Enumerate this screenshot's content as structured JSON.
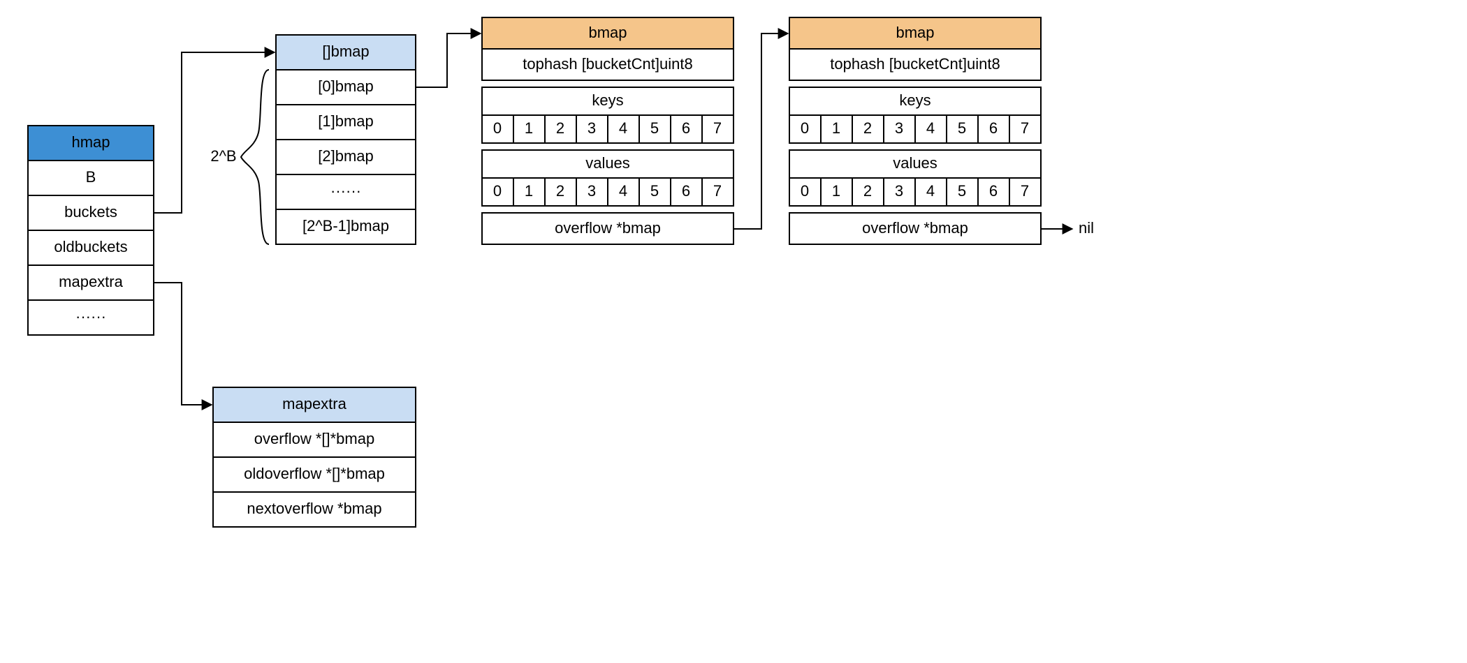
{
  "hmap": {
    "title": "hmap",
    "fields": [
      "B",
      "buckets",
      "oldbuckets",
      "mapextra",
      "······"
    ]
  },
  "bucketArray": {
    "title": "[]bmap",
    "sizeLabel": "2^B",
    "items": [
      "[0]bmap",
      "[1]bmap",
      "[2]bmap",
      "······",
      "[2^B-1]bmap"
    ]
  },
  "bmap": {
    "title": "bmap",
    "tophash": "tophash [bucketCnt]uint8",
    "keysLabel": "keys",
    "valuesLabel": "values",
    "slots": [
      "0",
      "1",
      "2",
      "3",
      "4",
      "5",
      "6",
      "7"
    ],
    "overflow": "overflow *bmap"
  },
  "nilLabel": "nil",
  "mapextra": {
    "title": "mapextra",
    "fields": [
      "overflow *[]*bmap",
      "oldoverflow *[]*bmap",
      "nextoverflow *bmap"
    ]
  },
  "chart_data": {
    "type": "graph",
    "nodes": [
      {
        "id": "hmap",
        "fields": [
          "B",
          "buckets",
          "oldbuckets",
          "mapextra",
          "..."
        ]
      },
      {
        "id": "bucket_array",
        "label": "[]bmap",
        "size": "2^B",
        "entries": [
          "[0]bmap",
          "[1]bmap",
          "[2]bmap",
          "...",
          "[2^B-1]bmap"
        ]
      },
      {
        "id": "bmap1",
        "label": "bmap",
        "rows": [
          "tophash [bucketCnt]uint8",
          "keys",
          [
            0,
            1,
            2,
            3,
            4,
            5,
            6,
            7
          ],
          "values",
          [
            0,
            1,
            2,
            3,
            4,
            5,
            6,
            7
          ],
          "overflow *bmap"
        ]
      },
      {
        "id": "bmap2",
        "label": "bmap",
        "rows": [
          "tophash [bucketCnt]uint8",
          "keys",
          [
            0,
            1,
            2,
            3,
            4,
            5,
            6,
            7
          ],
          "values",
          [
            0,
            1,
            2,
            3,
            4,
            5,
            6,
            7
          ],
          "overflow *bmap"
        ]
      },
      {
        "id": "mapextra",
        "fields": [
          "overflow *[]*bmap",
          "oldoverflow *[]*bmap",
          "nextoverflow *bmap"
        ]
      },
      {
        "id": "nil",
        "label": "nil"
      }
    ],
    "edges": [
      {
        "from": "hmap.buckets",
        "to": "bucket_array"
      },
      {
        "from": "bucket_array[0]",
        "to": "bmap1"
      },
      {
        "from": "hmap.mapextra",
        "to": "mapextra"
      },
      {
        "from": "bmap1.overflow",
        "to": "bmap2"
      },
      {
        "from": "bmap2.overflow",
        "to": "nil"
      }
    ]
  }
}
